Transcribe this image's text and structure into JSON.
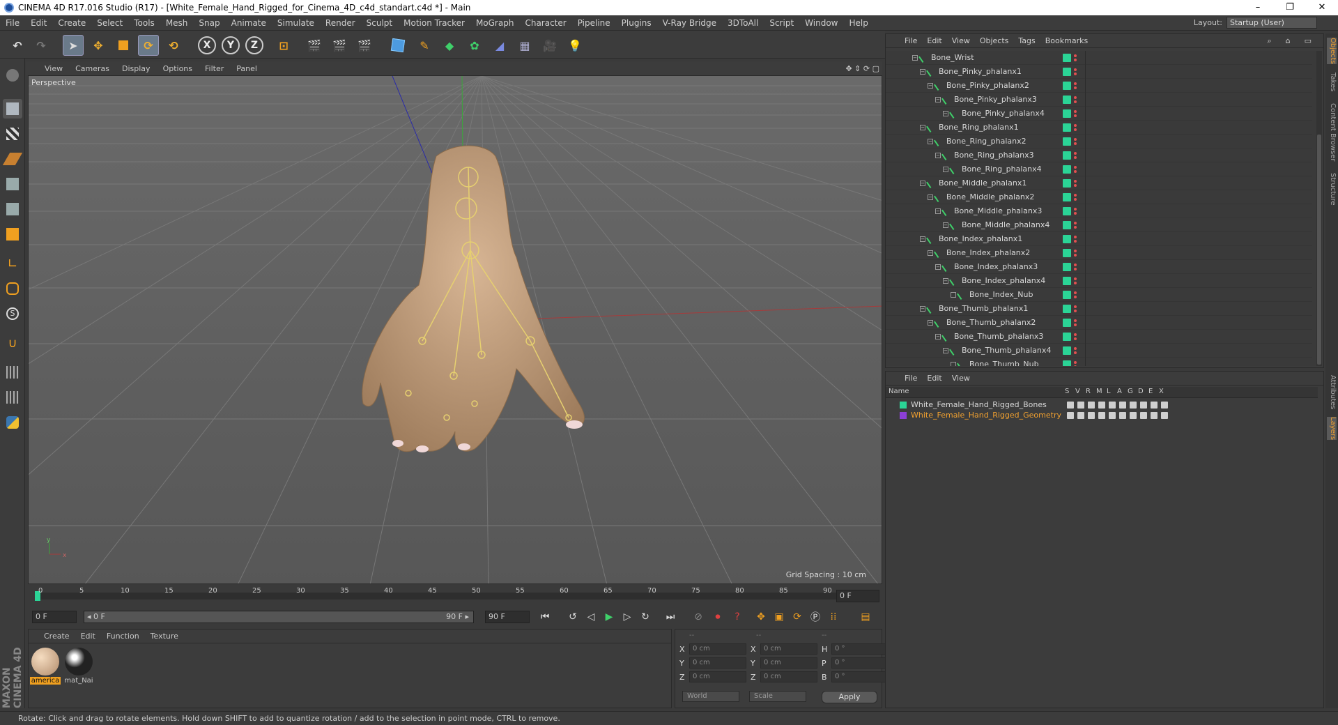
{
  "window": {
    "title": "CINEMA 4D R17.016 Studio (R17) - [White_Female_Hand_Rigged_for_Cinema_4D_c4d_standart.c4d *] - Main",
    "minimize": "–",
    "maximize": "❐",
    "close": "✕"
  },
  "menubar": {
    "items": [
      "File",
      "Edit",
      "Create",
      "Select",
      "Tools",
      "Mesh",
      "Snap",
      "Animate",
      "Simulate",
      "Render",
      "Sculpt",
      "Motion Tracker",
      "MoGraph",
      "Character",
      "Pipeline",
      "Plugins",
      "V-Ray Bridge",
      "3DToAll",
      "Script",
      "Window",
      "Help"
    ],
    "layout_label": "Layout:",
    "layout_value": "Startup (User)"
  },
  "toolbar": {
    "axis_x": "X",
    "axis_y": "Y",
    "axis_z": "Z"
  },
  "viewport": {
    "menu": [
      "View",
      "Cameras",
      "Display",
      "Options",
      "Filter",
      "Panel"
    ],
    "label": "Perspective",
    "grid_spacing": "Grid Spacing : 10 cm",
    "axis_x": "x",
    "axis_y": "y"
  },
  "timeline": {
    "ticks": [
      "0",
      "5",
      "10",
      "15",
      "20",
      "25",
      "30",
      "35",
      "40",
      "45",
      "50",
      "55",
      "60",
      "65",
      "70",
      "75",
      "80",
      "85",
      "90"
    ],
    "current_frame": "0 F",
    "start_field": "0 F",
    "range_start": "◂ 0 F",
    "range_end": "90 F ▸",
    "end_field": "90 F"
  },
  "material_panel": {
    "menu": [
      "Create",
      "Edit",
      "Function",
      "Texture"
    ],
    "materials": [
      {
        "name": "america",
        "color": "#e8c9a8"
      },
      {
        "name": "mat_Nai",
        "color": "#2a1f1f"
      }
    ]
  },
  "coords": {
    "header": [
      "--",
      "--",
      "--"
    ],
    "rows": [
      {
        "a1": "X",
        "v1": "0 cm",
        "a2": "X",
        "v2": "0 cm",
        "a3": "H",
        "v3": "0 °"
      },
      {
        "a1": "Y",
        "v1": "0 cm",
        "a2": "Y",
        "v2": "0 cm",
        "a3": "P",
        "v3": "0 °"
      },
      {
        "a1": "Z",
        "v1": "0 cm",
        "a2": "Z",
        "v2": "0 cm",
        "a3": "B",
        "v3": "0 °"
      }
    ],
    "world": "World",
    "scale": "Scale",
    "apply": "Apply"
  },
  "status": {
    "text": "Rotate: Click and drag to rotate elements. Hold down SHIFT to add to quantize rotation / add to the selection in point mode, CTRL to remove.",
    "logo": "MAXON CINEMA 4D"
  },
  "object_manager": {
    "menu": [
      "File",
      "Edit",
      "View",
      "Objects",
      "Tags",
      "Bookmarks"
    ],
    "objects": [
      {
        "name": "Bone_Wrist",
        "depth": 0
      },
      {
        "name": "Bone_Pinky_phalanx1",
        "depth": 1
      },
      {
        "name": "Bone_Pinky_phalanx2",
        "depth": 2
      },
      {
        "name": "Bone_Pinky_phalanx3",
        "depth": 3
      },
      {
        "name": "Bone_Pinky_phalanx4",
        "depth": 4
      },
      {
        "name": "Bone_Ring_phalanx1",
        "depth": 1
      },
      {
        "name": "Bone_Ring_phalanx2",
        "depth": 2
      },
      {
        "name": "Bone_Ring_phalanx3",
        "depth": 3
      },
      {
        "name": "Bone_Ring_phalanx4",
        "depth": 4
      },
      {
        "name": "Bone_Middle_phalanx1",
        "depth": 1
      },
      {
        "name": "Bone_Middle_phalanx2",
        "depth": 2
      },
      {
        "name": "Bone_Middle_phalanx3",
        "depth": 3
      },
      {
        "name": "Bone_Middle_phalanx4",
        "depth": 4
      },
      {
        "name": "Bone_Index_phalanx1",
        "depth": 1
      },
      {
        "name": "Bone_Index_phalanx2",
        "depth": 2
      },
      {
        "name": "Bone_Index_phalanx3",
        "depth": 3
      },
      {
        "name": "Bone_Index_phalanx4",
        "depth": 4
      },
      {
        "name": "Bone_Index_Nub",
        "depth": 5
      },
      {
        "name": "Bone_Thumb_phalanx1",
        "depth": 1
      },
      {
        "name": "Bone_Thumb_phalanx2",
        "depth": 2
      },
      {
        "name": "Bone_Thumb_phalanx3",
        "depth": 3
      },
      {
        "name": "Bone_Thumb_phalanx4",
        "depth": 4
      },
      {
        "name": "Bone_Thumb_Nub",
        "depth": 5
      }
    ]
  },
  "layer_manager": {
    "menu": [
      "File",
      "Edit",
      "View"
    ],
    "columns": [
      "Name",
      "S",
      "V",
      "R",
      "M",
      "L",
      "A",
      "G",
      "D",
      "E",
      "X"
    ],
    "layers": [
      {
        "name": "White_Female_Hand_Rigged_Bones",
        "color": "#2bd496",
        "text_color": "#d8d8d8"
      },
      {
        "name": "White_Female_Hand_Rigged_Geometry",
        "color": "#8b3fd6",
        "text_color": "#f0a030"
      }
    ]
  },
  "side_tabs": [
    "Objects",
    "Takes",
    "Content Browser",
    "Structure",
    "Attributes",
    "Layers"
  ]
}
